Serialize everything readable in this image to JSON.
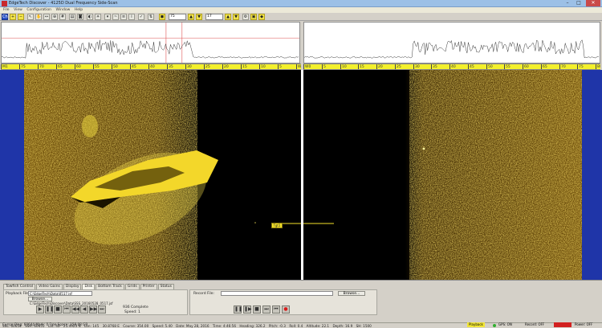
{
  "window": {
    "title": "EdgeTech Discover - 4125D Dual Frequency Side-Scan",
    "min": "–",
    "max": "□",
    "close": "✕"
  },
  "menu": [
    "File",
    "View",
    "Configuration",
    "Window",
    "Help"
  ],
  "toolbar": {
    "zoom_field": "75",
    "gain_field": "17",
    "freq_label": "Ch"
  },
  "ruler": {
    "left_ticks": [
      "M1",
      "75",
      "70",
      "65",
      "60",
      "55",
      "50",
      "45",
      "40",
      "35",
      "30",
      "25",
      "20",
      "15",
      "10",
      "5",
      "W1"
    ],
    "right_ticks": [
      "W0",
      "5",
      "10",
      "15",
      "20",
      "25",
      "30",
      "35",
      "40",
      "45",
      "50",
      "55",
      "60",
      "65",
      "70",
      "75",
      "80"
    ]
  },
  "sonar": {
    "marker_label": "Tgt1"
  },
  "bottom": {
    "tabs": [
      "Towfish Control",
      "Video Gains",
      "Display",
      "Disk",
      "Bottom Track",
      "Grids",
      "Printer",
      "Status"
    ],
    "active_tab": "Disk",
    "playback_label": "Playback File:",
    "playback_file": "C:\\EdgeTech\\Data\\0517.jsf",
    "browse_label": "Browse...",
    "playback_path": "C:\\EdgeTech\\Discover\\Data\\SSS_20160528_0517.jsf",
    "complete_label": "936 Complete",
    "speed_label": "Speed: 1",
    "record_label": "Record File:",
    "record_browse_label": "Browse..."
  },
  "status": {
    "ssl": "SSL: 60654",
    "ssh": "SSH: 60655",
    "lat": "Lat: 40",
    "lat_val": "25.4923 N",
    "lon": "Lon: 145",
    "lon_val": "30.8768 E",
    "course": "Course: 354.00",
    "speed": "Speed: 5.40",
    "date": "Date: May 28, 2016",
    "time": "Time: 4:46:56",
    "heading": "Heading: 326.2",
    "pitch": "Pitch: -0.3",
    "roll": "Roll: 0.4",
    "altitude": "Altitude: 22.1",
    "depth": "Depth: 16.9",
    "sh": "SH: 1500",
    "row2_left": "Cursor  Ping: 60644  Mark: 0  Free Space: 158.08 GB",
    "playback": "Playback",
    "gps": "GPS: ON",
    "record": "Record: OFF",
    "power": "Power: OFF"
  },
  "colors": {
    "sonar_background": "#1f35a8",
    "sonar_bright": "#f4e022",
    "ruler": "#f3f02c",
    "record_dot": "#d81a1a"
  }
}
